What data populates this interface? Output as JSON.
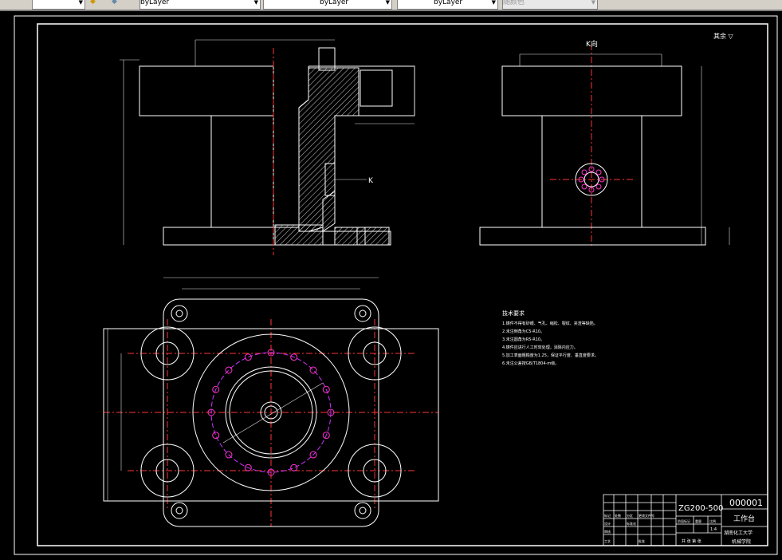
{
  "toolbar": {
    "color": "byLayer",
    "linetype": "byLayer",
    "lineweight": "byLayer",
    "plotstyle": "随颜色"
  },
  "drawing": {
    "view_label": "K向",
    "section_label": "K",
    "roughness_note": "其余 ▽",
    "tech_title": "技术要求",
    "tech_items": [
      "1.铸件不得有砂眼、气孔、缩松、裂纹、夹渣等缺陷。",
      "2.未注倒角为C5-R10。",
      "3.未注圆角为R5-R10。",
      "4.铸件应进行人工时效处理，消除内应力。",
      "5.加工表面粗糙度为1.25，保证平行度、垂直度要求。",
      "6.未注公差按GB/T1804-m级。"
    ],
    "title_block": {
      "drawing_no": "ZG200-500",
      "code": "000001",
      "part_name": "工作台",
      "school": "湖南化工大学",
      "dept": "机械学院",
      "scale": "1:4",
      "sheet": "共 张 第 张",
      "labels": [
        "标记",
        "处数",
        "分区",
        "更改文件号",
        "设计",
        "标准化",
        "审核",
        "工艺",
        "批准",
        "阶段标记",
        "重量",
        "比例"
      ]
    }
  }
}
